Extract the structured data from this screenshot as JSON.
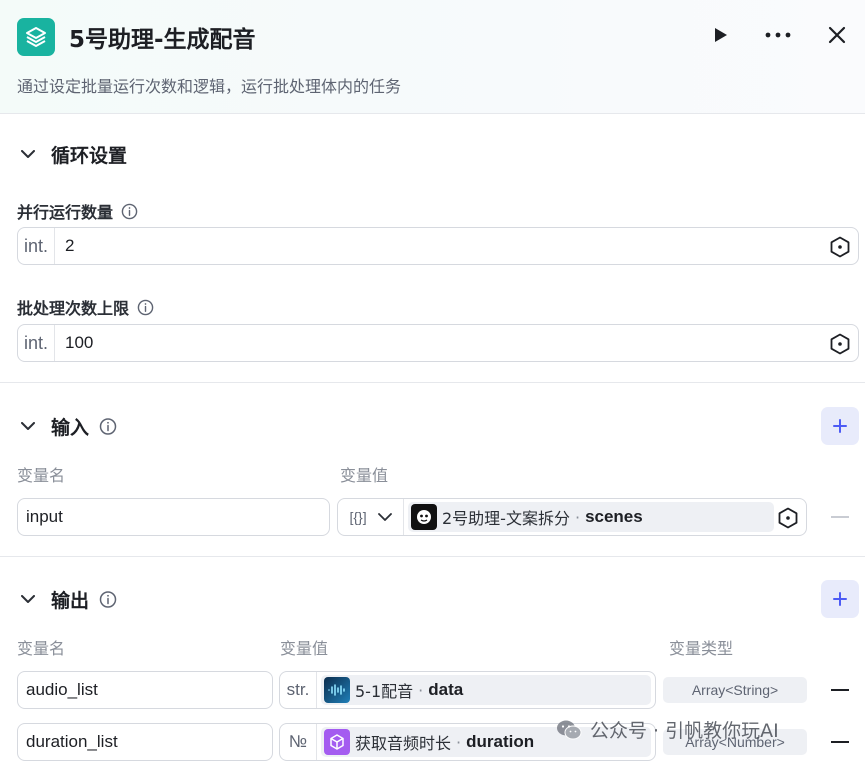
{
  "header": {
    "title": "5号助理-生成配音",
    "description": "通过设定批量运行次数和逻辑，运行批处理体内的任务",
    "icons": [
      "layers-icon",
      "play-icon",
      "more-icon",
      "close-icon"
    ]
  },
  "loop_settings": {
    "section_title": "循环设置",
    "parallel": {
      "label": "并行运行数量",
      "type_tag": "int.",
      "value": "2"
    },
    "batch_limit": {
      "label": "批处理次数上限",
      "type_tag": "int.",
      "value": "100"
    }
  },
  "input": {
    "section_title": "输入",
    "col_name": "变量名",
    "col_value": "变量值",
    "rows": [
      {
        "name": "input",
        "type_tag": "[{}]",
        "node": "2号助理-文案拆分",
        "separator": "·",
        "var": "scenes"
      }
    ]
  },
  "output": {
    "section_title": "输出",
    "col_name": "变量名",
    "col_value": "变量值",
    "col_type": "变量类型",
    "rows": [
      {
        "name": "audio_list",
        "type_tag": "str.",
        "node": "5-1配音",
        "separator": "·",
        "var": "data",
        "var_type": "Array<String>"
      },
      {
        "name": "duration_list",
        "type_tag": "№",
        "node": "获取音频时长",
        "separator": "·",
        "var": "duration",
        "var_type": "Array<Number>"
      }
    ]
  },
  "watermark": "公众号 · 引帆教你玩AI",
  "colors": {
    "accent": "#19b3a0",
    "add_button_bg": "#e8ebfb",
    "add_icon": "#4d5bf5"
  }
}
